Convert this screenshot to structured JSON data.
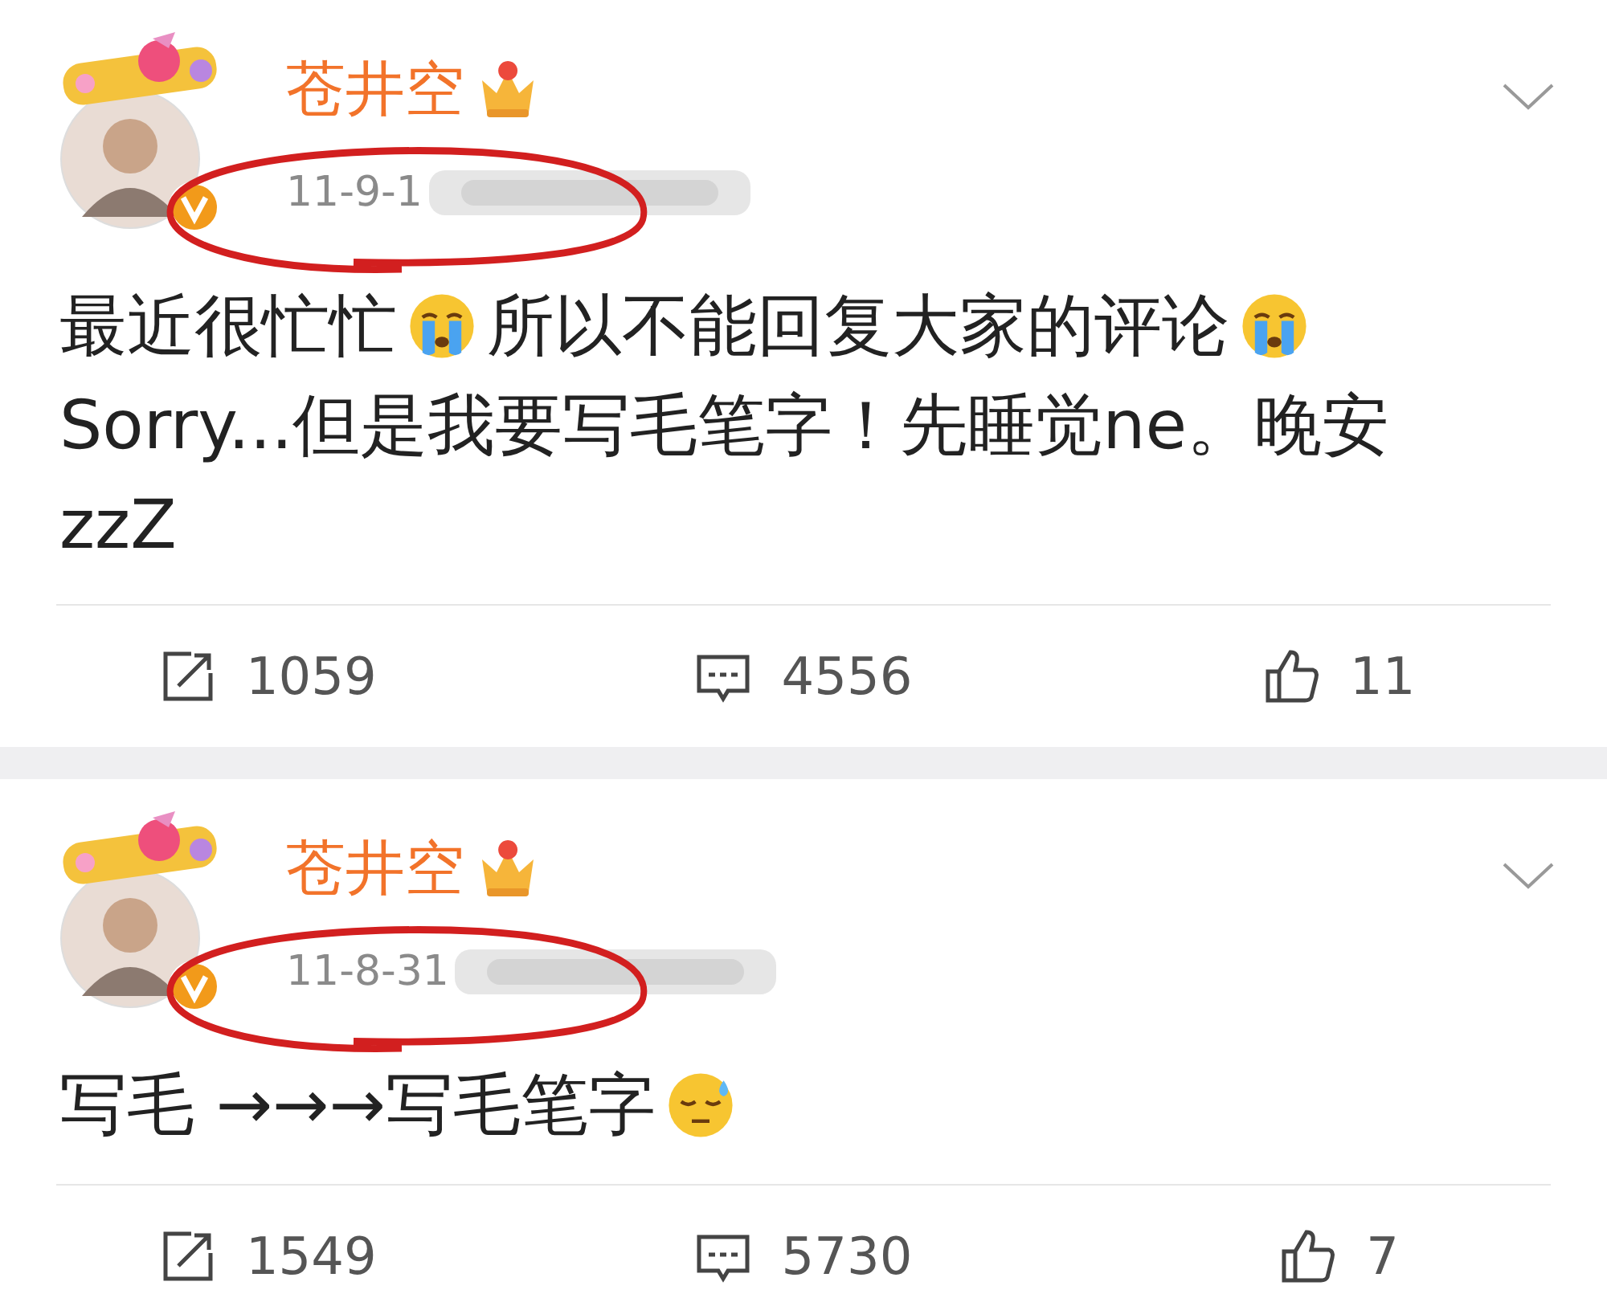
{
  "posts": [
    {
      "author": "苍井空",
      "date": "11-9-1",
      "lines": [
        [
          {
            "kind": "text",
            "text": "最近很忙忙"
          },
          {
            "kind": "cry"
          },
          {
            "kind": "text",
            "text": "所以不能回复大家的评论"
          },
          {
            "kind": "cry"
          }
        ],
        [
          {
            "kind": "text",
            "text": "Sorry...但是我要写毛笔字！先睡觉ne。晚安"
          }
        ],
        [
          {
            "kind": "text",
            "text": "zzZ"
          }
        ]
      ],
      "reposts": "1059",
      "comments": "4556",
      "likes": "11"
    },
    {
      "author": "苍井空",
      "date": "11-8-31",
      "lines": [
        [
          {
            "kind": "text",
            "text": "写毛 →→→写毛笔字"
          },
          {
            "kind": "sweat"
          }
        ]
      ],
      "reposts": "1549",
      "comments": "5730",
      "likes": "7"
    }
  ]
}
